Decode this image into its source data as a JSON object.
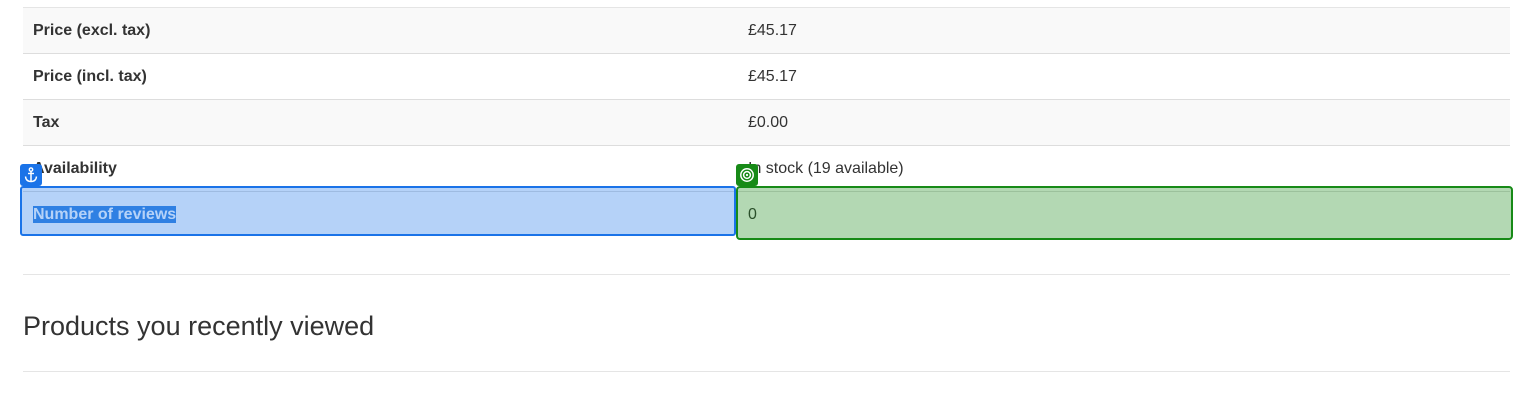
{
  "product_info": {
    "rows": [
      {
        "label": "Price (excl. tax)",
        "value": "£45.17"
      },
      {
        "label": "Price (incl. tax)",
        "value": "£45.17"
      },
      {
        "label": "Tax",
        "value": "£0.00"
      },
      {
        "label": "Availability",
        "value": "In stock (19 available)"
      },
      {
        "label": "Number of reviews",
        "value": "0"
      }
    ]
  },
  "overlay": {
    "anchor_icon": "anchor-icon",
    "target_icon": "target-icon",
    "anchor_color": "#1a73e8",
    "target_color": "#178a17"
  },
  "recently_viewed": {
    "title": "Products you recently viewed"
  }
}
